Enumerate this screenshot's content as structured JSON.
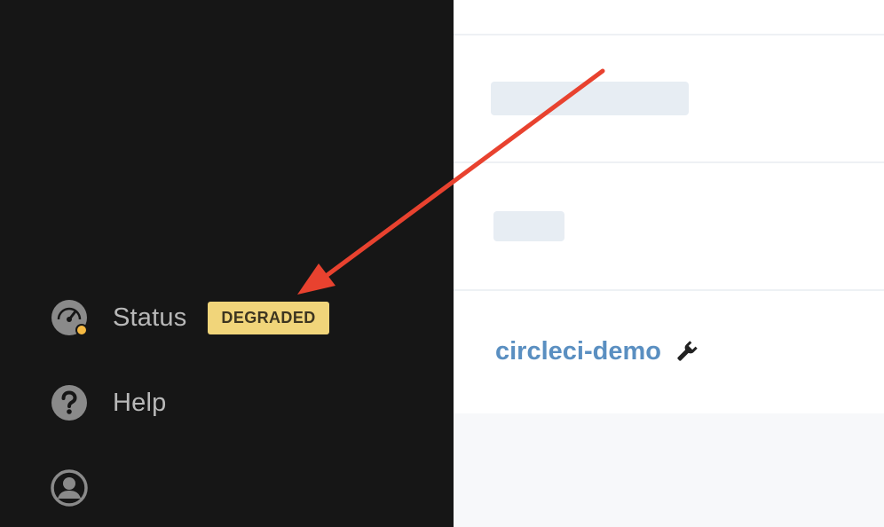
{
  "sidebar": {
    "status": {
      "label": "Status",
      "badge": "DEGRADED",
      "icon": "gauge-icon",
      "badge_color": "#f1d57a",
      "indicator_color": "#f5b942"
    },
    "help": {
      "label": "Help",
      "icon": "question-circle-icon"
    },
    "account": {
      "icon": "user-avatar-icon"
    }
  },
  "main": {
    "project": {
      "name": "circleci-demo",
      "icon": "wrench-icon",
      "link_color": "#5a8fc1"
    }
  },
  "annotation": {
    "arrow_color": "#e8422f"
  }
}
